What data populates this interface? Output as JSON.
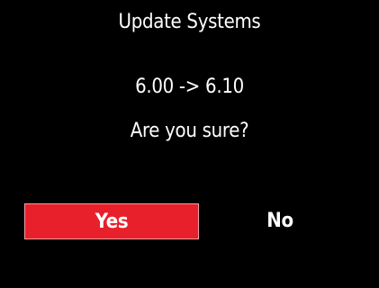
{
  "dialog": {
    "title": "Update Systems",
    "version_change": "6.00 -> 6.10",
    "question": "Are you sure?"
  },
  "buttons": {
    "yes_label": "Yes",
    "no_label": "No",
    "selected": "yes"
  },
  "colors": {
    "background": "#000000",
    "text": "#ffffff",
    "selected_button": "#e8202b"
  }
}
